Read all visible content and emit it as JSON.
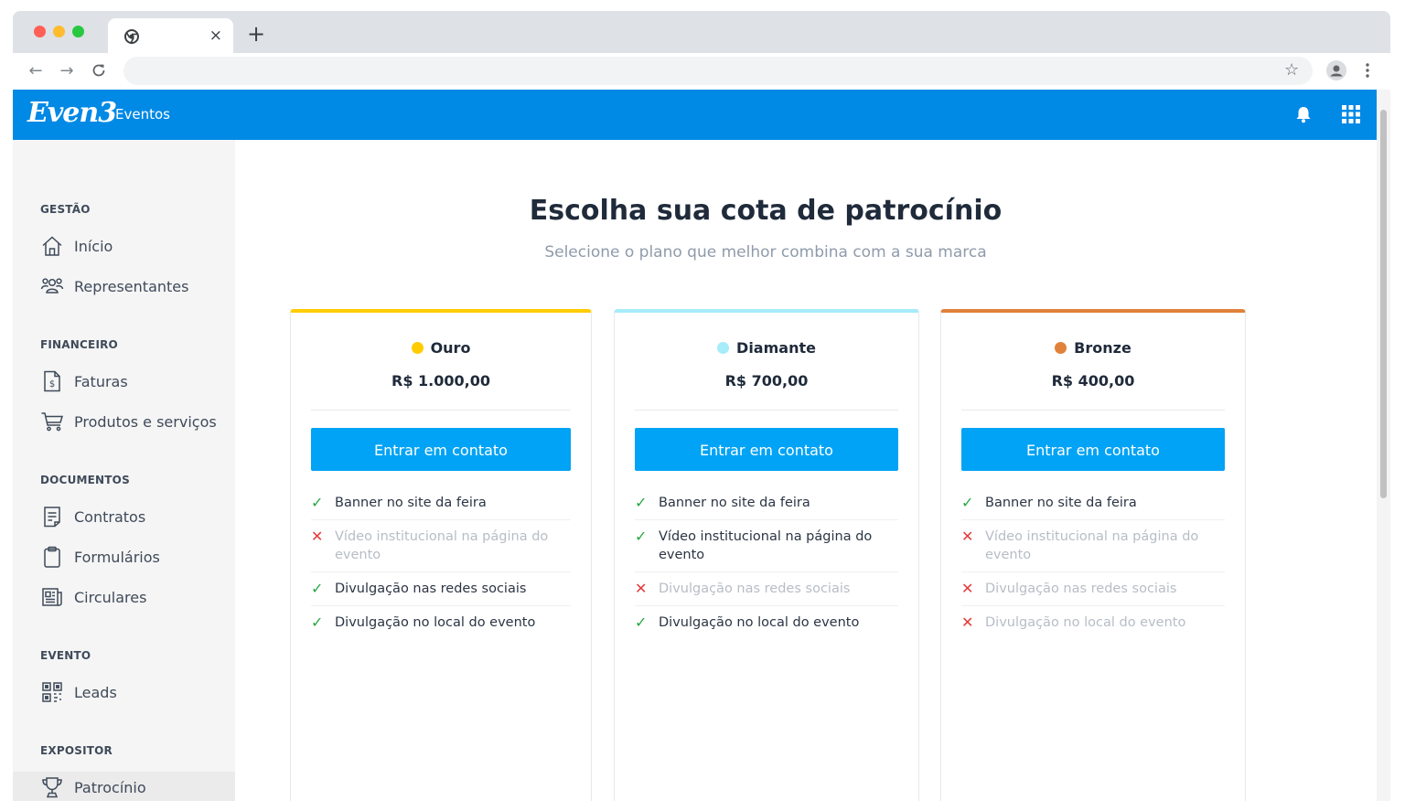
{
  "browser": {
    "tab_close": "×",
    "new_tab": "+",
    "back": "←",
    "forward": "→",
    "reload": "C",
    "star": "☆",
    "traffic_colors": [
      "#ff5f57",
      "#febc2e",
      "#28c840"
    ]
  },
  "app": {
    "logo": "Even3",
    "logo_sub": "Eventos",
    "brand_color": "#0089e5"
  },
  "sidebar": {
    "sections": [
      {
        "label": "GESTÃO",
        "items": [
          {
            "label": "Início",
            "icon": "home-icon"
          },
          {
            "label": "Representantes",
            "icon": "users-icon"
          }
        ]
      },
      {
        "label": "FINANCEIRO",
        "items": [
          {
            "label": "Faturas",
            "icon": "invoice-icon"
          },
          {
            "label": "Produtos e serviços",
            "icon": "cart-icon"
          }
        ]
      },
      {
        "label": "DOCUMENTOS",
        "items": [
          {
            "label": "Contratos",
            "icon": "contract-icon"
          },
          {
            "label": "Formulários",
            "icon": "clipboard-icon"
          },
          {
            "label": "Circulares",
            "icon": "newspaper-icon"
          }
        ]
      },
      {
        "label": "EVENTO",
        "items": [
          {
            "label": "Leads",
            "icon": "qr-code-icon"
          }
        ]
      },
      {
        "label": "EXPOSITOR",
        "items": [
          {
            "label": "Patrocínio",
            "icon": "trophy-icon",
            "active": true
          }
        ]
      }
    ]
  },
  "main": {
    "title": "Escolha sua cota de patrocínio",
    "subtitle": "Selecione o plano que melhor combina com a sua marca"
  },
  "plans": [
    {
      "name": "Ouro",
      "price": "R$ 1.000,00",
      "color": "#ffcc00",
      "cta": "Entrar em contato",
      "features": [
        {
          "text": "Banner no site da feira",
          "included": true
        },
        {
          "text": "Vídeo institucional na página do evento",
          "included": false
        },
        {
          "text": "Divulgação nas redes sociais",
          "included": true
        },
        {
          "text": "Divulgação no local do evento",
          "included": true
        }
      ]
    },
    {
      "name": "Diamante",
      "price": "R$ 700,00",
      "color": "#a6ecfa",
      "cta": "Entrar em contato",
      "features": [
        {
          "text": "Banner no site da feira",
          "included": true
        },
        {
          "text": "Vídeo institucional na página do evento",
          "included": true
        },
        {
          "text": "Divulgação nas redes sociais",
          "included": false
        },
        {
          "text": "Divulgação no local do evento",
          "included": true
        }
      ]
    },
    {
      "name": "Bronze",
      "price": "R$ 400,00",
      "color": "#e0823a",
      "cta": "Entrar em contato",
      "features": [
        {
          "text": "Banner no site da feira",
          "included": true
        },
        {
          "text": "Vídeo institucional na página do evento",
          "included": false
        },
        {
          "text": "Divulgação nas redes sociais",
          "included": false
        },
        {
          "text": "Divulgação no local do evento",
          "included": false
        }
      ]
    }
  ],
  "marks": {
    "check": "✓",
    "cross": "✕"
  }
}
